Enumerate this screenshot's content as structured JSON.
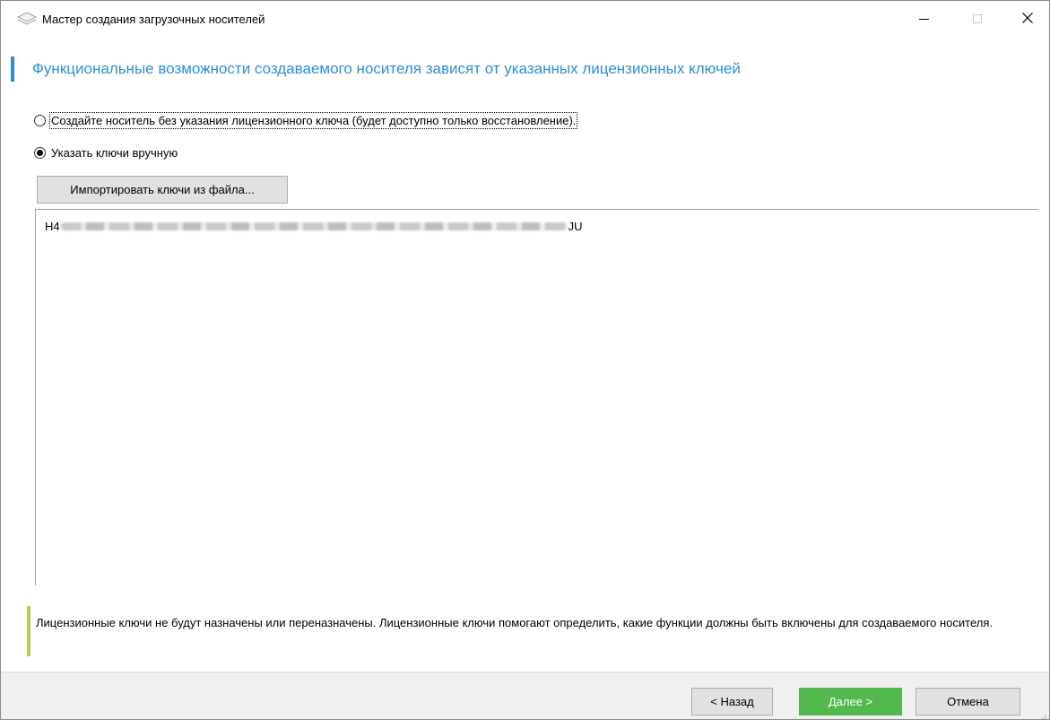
{
  "window": {
    "title": "Мастер создания загрузочных носителей",
    "icon": "wizard-layers-icon"
  },
  "header": {
    "text": "Функциональные возможности создаваемого носителя зависят от указанных лицензионных ключей",
    "accent_color": "#2a8ad6"
  },
  "options": {
    "no_key_label": "Создайте носитель без указания лицензионного ключа (будет доступно только восстановление).",
    "manual_label": "Указать ключи вручную",
    "selected": "manual"
  },
  "import_button_label": "Импортировать ключи из файла...",
  "keys": {
    "prefix": "H4",
    "suffix": "JU"
  },
  "info": {
    "text": "Лицензионные ключи не будут назначены или переназначены. Лицензионные ключи помогают определить, какие функции должны быть включены для создаваемого носителя.",
    "accent_color": "#b6cc58"
  },
  "buttons": {
    "back": "< Назад",
    "next": "Далее >",
    "cancel": "Отмена",
    "next_color": "#53b94e"
  }
}
